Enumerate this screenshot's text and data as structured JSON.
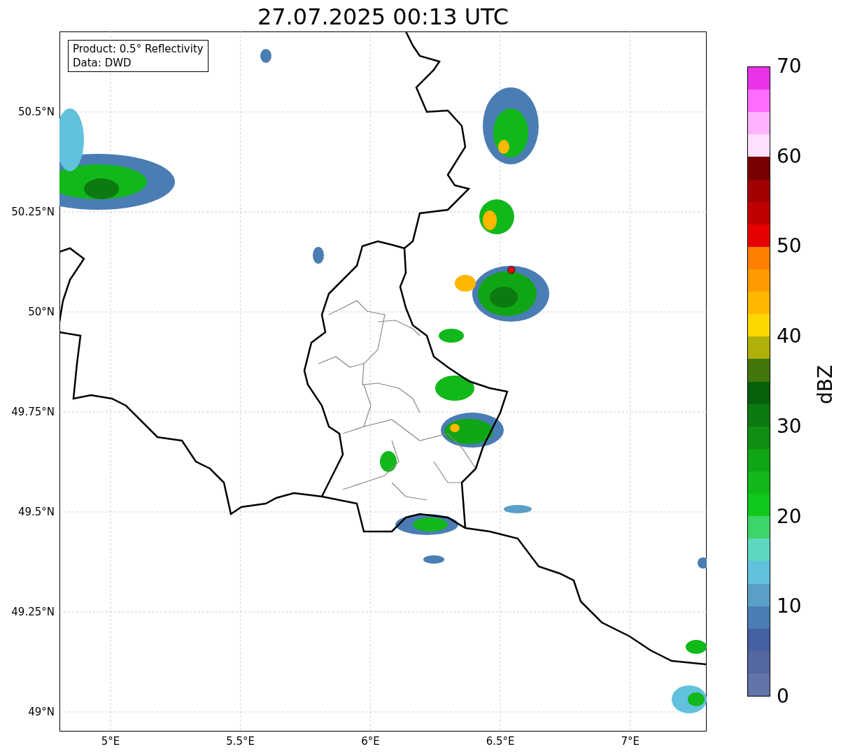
{
  "title": "27.07.2025 00:13 UTC",
  "legend": [
    "Product: 0.5° Reflectivity",
    "Data: DWD"
  ],
  "lat_ticks": [
    "50.5°N",
    "50.25°N",
    "50°N",
    "49.75°N",
    "49.5°N",
    "49.25°N",
    "49°N"
  ],
  "lon_ticks": [
    "5°E",
    "5.5°E",
    "6°E",
    "6.5°E",
    "7°E"
  ],
  "colorbar": {
    "label": "dBZ",
    "ticks": [
      "70",
      "60",
      "50",
      "40",
      "30",
      "20",
      "10",
      "0"
    ],
    "segments": [
      {
        "color": "#e933e9"
      },
      {
        "color": "#ff6cff"
      },
      {
        "color": "#ffb3ff"
      },
      {
        "color": "#ffe0ff"
      },
      {
        "color": "#780000"
      },
      {
        "color": "#a00000"
      },
      {
        "color": "#c00000"
      },
      {
        "color": "#e60000"
      },
      {
        "color": "#ff7f00"
      },
      {
        "color": "#ff9a00"
      },
      {
        "color": "#ffb700"
      },
      {
        "color": "#ffd700"
      },
      {
        "color": "#b0b00a"
      },
      {
        "color": "#43760c"
      },
      {
        "color": "#07600b"
      },
      {
        "color": "#0c7a10"
      },
      {
        "color": "#0e8f12"
      },
      {
        "color": "#10a515"
      },
      {
        "color": "#10b81a"
      },
      {
        "color": "#11c91a"
      },
      {
        "color": "#3dd46a"
      },
      {
        "color": "#5dd8c0"
      },
      {
        "color": "#62c1dc"
      },
      {
        "color": "#5a9fc6"
      },
      {
        "color": "#4a7db3"
      },
      {
        "color": "#4560a3"
      },
      {
        "color": "#5567a0"
      },
      {
        "color": "#6374a8"
      }
    ]
  }
}
